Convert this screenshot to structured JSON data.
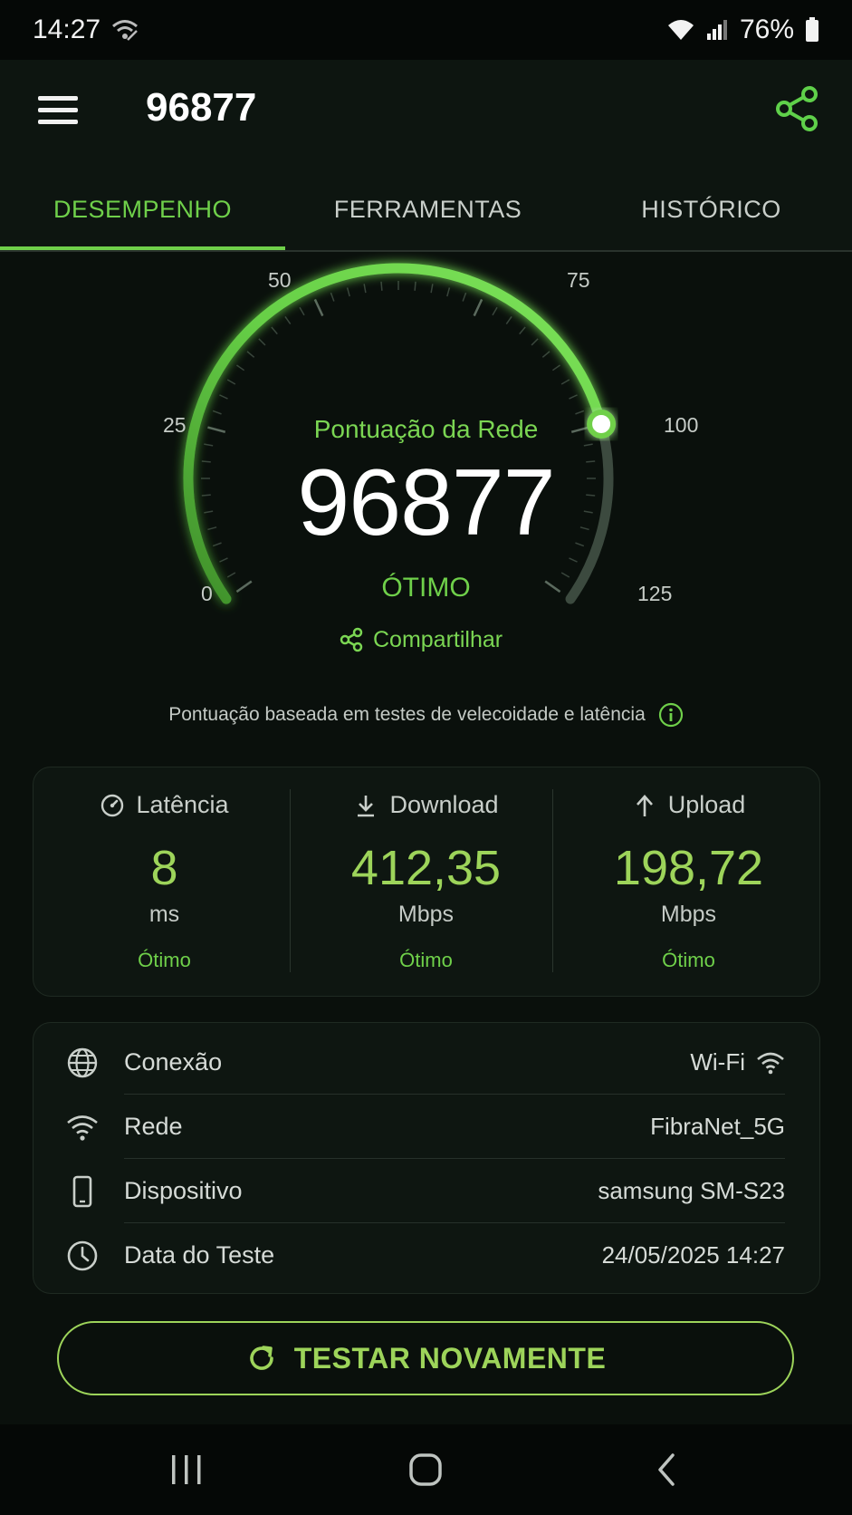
{
  "status_bar": {
    "time": "14:27",
    "battery": "76%"
  },
  "app_bar": {
    "title": "96877"
  },
  "tabs": [
    {
      "label": "DESEMPENHO",
      "active": true
    },
    {
      "label": "FERRAMENTAS",
      "active": false
    },
    {
      "label": "HISTÓRICO",
      "active": false
    }
  ],
  "gauge": {
    "title": "Pontuação da Rede",
    "score": "96877",
    "rating": "ÓTIMO",
    "share_label": "Compartilhar",
    "scale_labels": [
      "0",
      "25",
      "50",
      "75",
      "100",
      "125"
    ],
    "scale_max": 125,
    "needle_value": 100,
    "accent_color": "#6fd04a"
  },
  "basis_text": "Pontuação baseada em testes de velecoidade e latência",
  "metrics": [
    {
      "label": "Latência",
      "icon": "gauge-icon",
      "value": "8",
      "unit": "ms",
      "rating": "Ótimo"
    },
    {
      "label": "Download",
      "icon": "download-icon",
      "value": "412,35",
      "unit": "Mbps",
      "rating": "Ótimo"
    },
    {
      "label": "Upload",
      "icon": "upload-icon",
      "value": "198,72",
      "unit": "Mbps",
      "rating": "Ótimo"
    }
  ],
  "info": [
    {
      "label": "Conexão",
      "value": "Wi-Fi",
      "icon": "globe-icon"
    },
    {
      "label": "Rede",
      "value": "FibraNet_5G",
      "icon": "wifi-icon"
    },
    {
      "label": "Dispositivo",
      "value": "samsung SM-S23",
      "icon": "phone-icon"
    },
    {
      "label": "Data do Teste",
      "value": "24/05/2025 14:27",
      "icon": "clock-icon"
    }
  ],
  "retest_label": "TESTAR NOVAMENTE"
}
